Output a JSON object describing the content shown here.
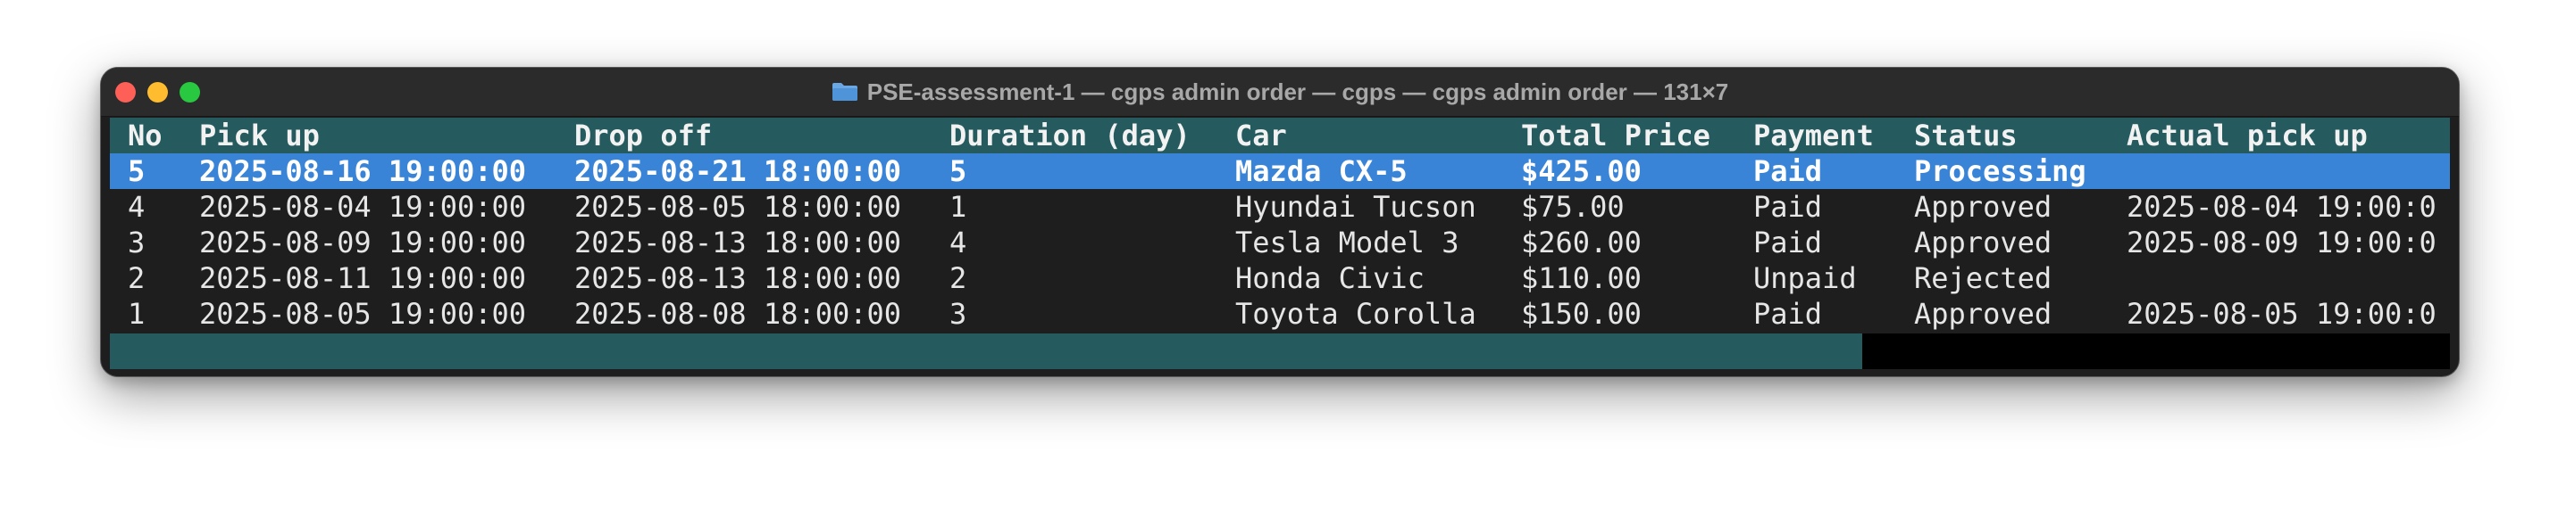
{
  "window": {
    "title": "PSE-assessment-1 — cgps admin order — cgps — cgps admin order — 131×7",
    "icon": "folder-icon",
    "colors": {
      "header_bg": "#255b5e",
      "selected_bg": "#3a84d8",
      "terminal_bg": "#1e1e1e"
    }
  },
  "table": {
    "headers": [
      "No",
      "Pick up",
      "Drop off",
      "Duration (day)",
      "Car",
      "Total Price",
      "Payment",
      "Status",
      "Actual pick up"
    ],
    "rows": [
      [
        "5",
        "2025-08-16 19:00:00",
        "2025-08-21 18:00:00",
        "5",
        "Mazda CX-5",
        "$425.00",
        "Paid",
        "Processing",
        ""
      ],
      [
        "4",
        "2025-08-04 19:00:00",
        "2025-08-05 18:00:00",
        "1",
        "Hyundai Tucson",
        "$75.00",
        "Paid",
        "Approved",
        "2025-08-04 19:00:0"
      ],
      [
        "3",
        "2025-08-09 19:00:00",
        "2025-08-13 18:00:00",
        "4",
        "Tesla Model 3",
        "$260.00",
        "Paid",
        "Approved",
        "2025-08-09 19:00:0"
      ],
      [
        "2",
        "2025-08-11 19:00:00",
        "2025-08-13 18:00:00",
        "2",
        "Honda Civic",
        "$110.00",
        "Unpaid",
        "Rejected",
        ""
      ],
      [
        "1",
        "2025-08-05 19:00:00",
        "2025-08-08 18:00:00",
        "3",
        "Toyota Corolla",
        "$150.00",
        "Paid",
        "Approved",
        "2025-08-05 19:00:0"
      ]
    ],
    "selected_row": 0
  }
}
